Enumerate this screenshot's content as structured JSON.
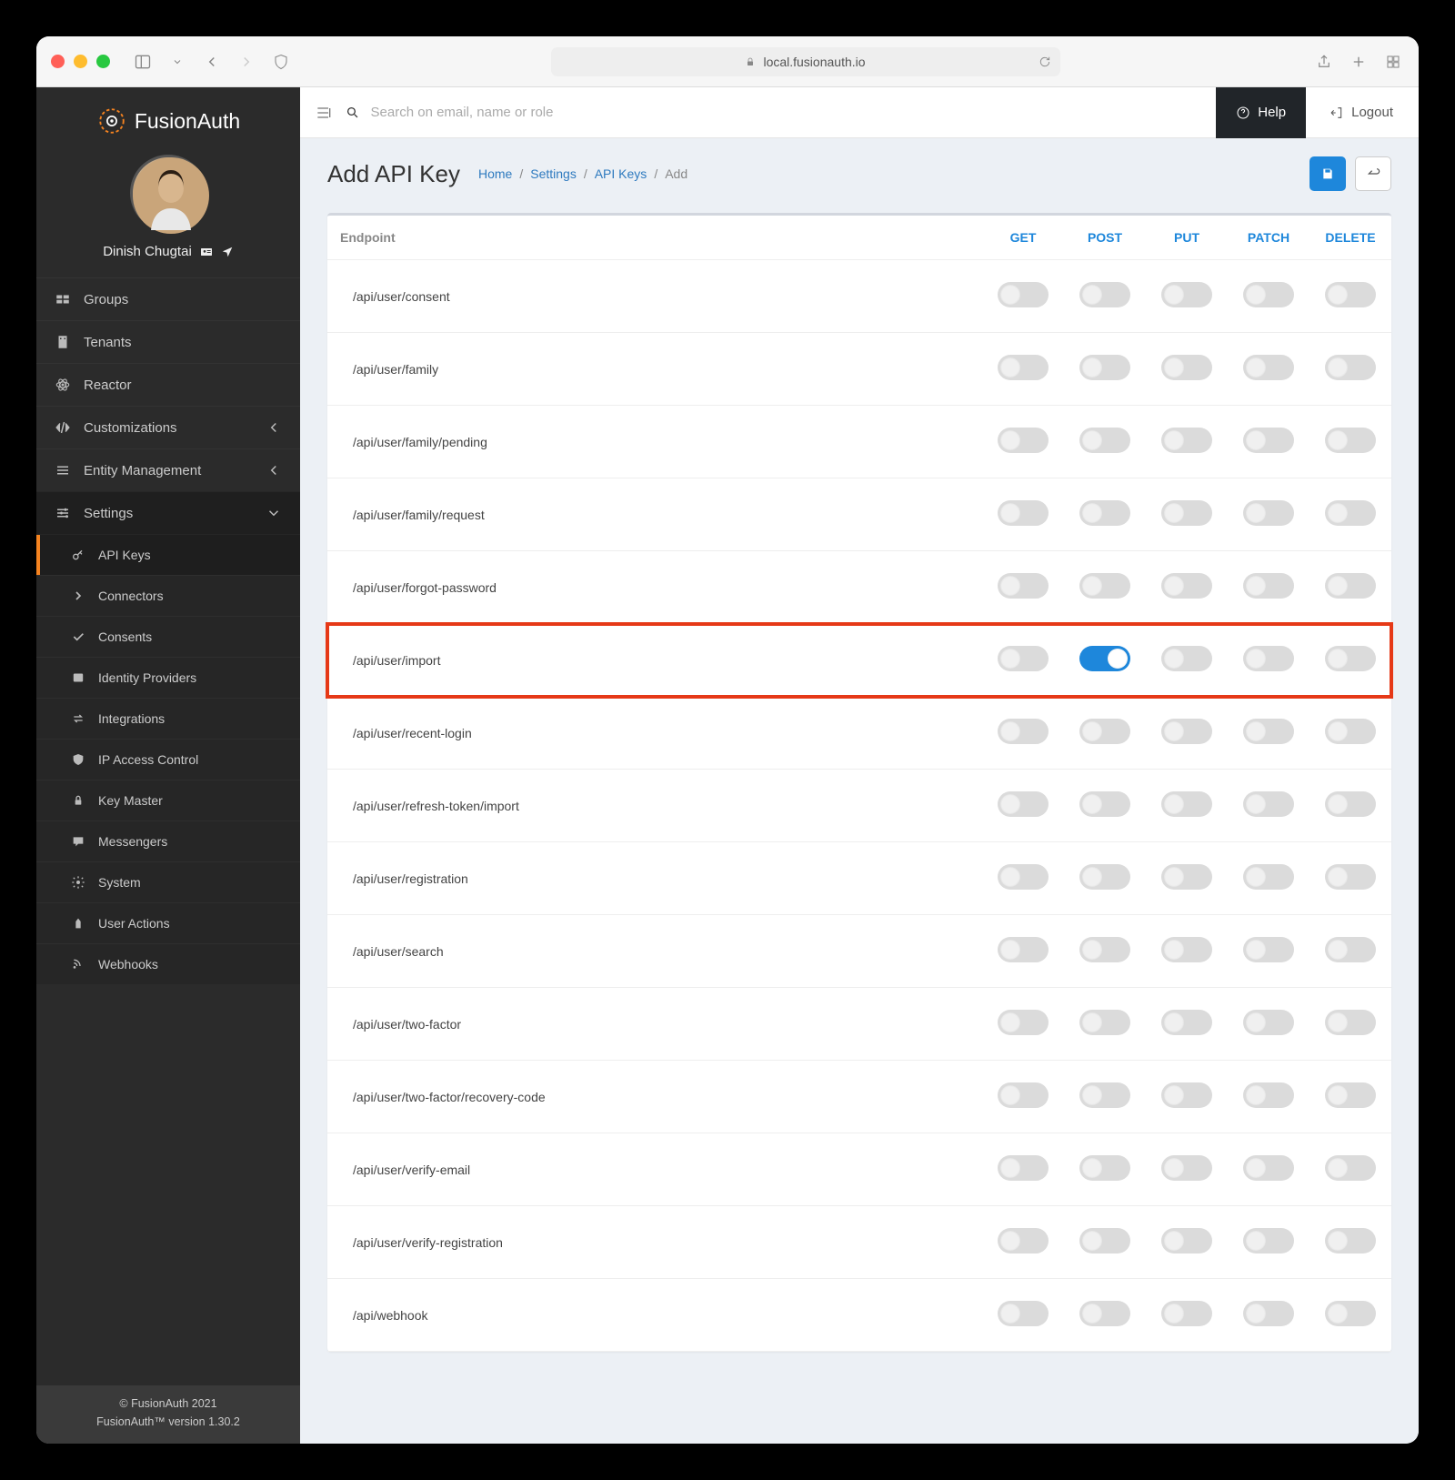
{
  "chrome": {
    "url": "local.fusionauth.io"
  },
  "brand": "FusionAuth",
  "user": {
    "name": "Dinish Chugtai"
  },
  "nav": {
    "groups": "Groups",
    "tenants": "Tenants",
    "reactor": "Reactor",
    "customizations": "Customizations",
    "entity": "Entity Management",
    "settings": "Settings",
    "api_keys": "API Keys",
    "connectors": "Connectors",
    "consents": "Consents",
    "idp": "Identity Providers",
    "integrations": "Integrations",
    "ipac": "IP Access Control",
    "key_master": "Key Master",
    "messengers": "Messengers",
    "system": "System",
    "user_actions": "User Actions",
    "webhooks": "Webhooks"
  },
  "footer": {
    "line1": "© FusionAuth 2021",
    "line2": "FusionAuth™ version 1.30.2"
  },
  "topbar": {
    "search_ph": "Search on email, name or role",
    "help": "Help",
    "logout": "Logout"
  },
  "page": {
    "title": "Add API Key",
    "crumbs": {
      "home": "Home",
      "settings": "Settings",
      "apikeys": "API Keys",
      "add": "Add"
    }
  },
  "table": {
    "headers": {
      "endpoint": "Endpoint",
      "get": "GET",
      "post": "POST",
      "put": "PUT",
      "patch": "PATCH",
      "delete": "DELETE"
    },
    "rows": [
      {
        "endpoint": "/api/user/consent",
        "state": {
          "get": false,
          "post": false,
          "put": false,
          "patch": false,
          "delete": false
        },
        "highlight": false
      },
      {
        "endpoint": "/api/user/family",
        "state": {
          "get": false,
          "post": false,
          "put": false,
          "patch": false,
          "delete": false
        },
        "highlight": false
      },
      {
        "endpoint": "/api/user/family/pending",
        "state": {
          "get": false,
          "post": false,
          "put": false,
          "patch": false,
          "delete": false
        },
        "highlight": false
      },
      {
        "endpoint": "/api/user/family/request",
        "state": {
          "get": false,
          "post": false,
          "put": false,
          "patch": false,
          "delete": false
        },
        "highlight": false
      },
      {
        "endpoint": "/api/user/forgot-password",
        "state": {
          "get": false,
          "post": false,
          "put": false,
          "patch": false,
          "delete": false
        },
        "highlight": false
      },
      {
        "endpoint": "/api/user/import",
        "state": {
          "get": false,
          "post": true,
          "put": false,
          "patch": false,
          "delete": false
        },
        "highlight": true
      },
      {
        "endpoint": "/api/user/recent-login",
        "state": {
          "get": false,
          "post": false,
          "put": false,
          "patch": false,
          "delete": false
        },
        "highlight": false
      },
      {
        "endpoint": "/api/user/refresh-token/import",
        "state": {
          "get": false,
          "post": false,
          "put": false,
          "patch": false,
          "delete": false
        },
        "highlight": false
      },
      {
        "endpoint": "/api/user/registration",
        "state": {
          "get": false,
          "post": false,
          "put": false,
          "patch": false,
          "delete": false
        },
        "highlight": false
      },
      {
        "endpoint": "/api/user/search",
        "state": {
          "get": false,
          "post": false,
          "put": false,
          "patch": false,
          "delete": false
        },
        "highlight": false
      },
      {
        "endpoint": "/api/user/two-factor",
        "state": {
          "get": false,
          "post": false,
          "put": false,
          "patch": false,
          "delete": false
        },
        "highlight": false
      },
      {
        "endpoint": "/api/user/two-factor/recovery-code",
        "state": {
          "get": false,
          "post": false,
          "put": false,
          "patch": false,
          "delete": false
        },
        "highlight": false
      },
      {
        "endpoint": "/api/user/verify-email",
        "state": {
          "get": false,
          "post": false,
          "put": false,
          "patch": false,
          "delete": false
        },
        "highlight": false
      },
      {
        "endpoint": "/api/user/verify-registration",
        "state": {
          "get": false,
          "post": false,
          "put": false,
          "patch": false,
          "delete": false
        },
        "highlight": false
      },
      {
        "endpoint": "/api/webhook",
        "state": {
          "get": false,
          "post": false,
          "put": false,
          "patch": false,
          "delete": false
        },
        "highlight": false
      }
    ]
  }
}
